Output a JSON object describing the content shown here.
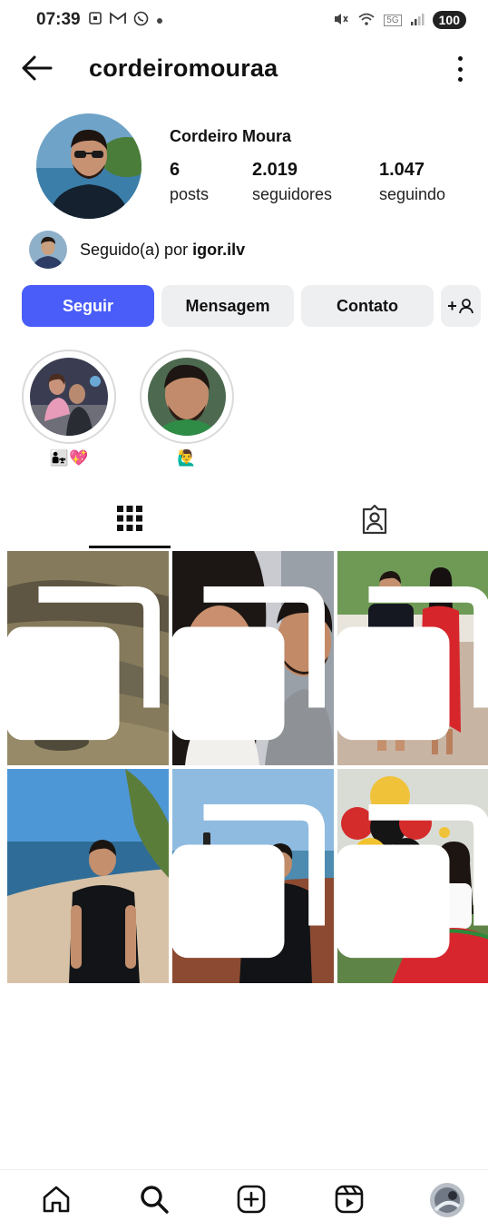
{
  "status_bar": {
    "time": "07:39",
    "left_icons": [
      "screenshot-icon",
      "gmail-icon",
      "whatsapp-icon",
      "dot-icon"
    ],
    "right_icons": [
      "mute-icon",
      "wifi-icon",
      "5g-icon",
      "signal-icon"
    ],
    "network": "5G",
    "battery": "100"
  },
  "header": {
    "username": "cordeiromouraa",
    "back_icon": "arrow-left-icon",
    "menu_icon": "kebab-menu-icon"
  },
  "profile": {
    "full_name": "Cordeiro Moura",
    "stats": [
      {
        "value": "6",
        "label": "posts"
      },
      {
        "value": "2.019",
        "label": "seguidores"
      },
      {
        "value": "1.047",
        "label": "seguindo"
      }
    ],
    "followed_by_prefix": "Seguido(a) por ",
    "followed_by_user": "igor.ilv"
  },
  "actions": {
    "follow": "Seguir",
    "message": "Mensagem",
    "contact": "Contato",
    "add_user_icon": "add-person-icon",
    "add_user_label": "+"
  },
  "highlights": [
    {
      "caption": "👨‍👧💖"
    },
    {
      "caption": "🙋‍♂️"
    }
  ],
  "tabs": {
    "active": "grid",
    "items": [
      "grid-icon",
      "tagged-icon"
    ]
  },
  "posts": [
    {
      "alt": "couple-on-rocks",
      "multi": true
    },
    {
      "alt": "selfie-couple",
      "multi": true
    },
    {
      "alt": "couple-deck",
      "multi": true
    },
    {
      "alt": "man-beach",
      "multi": false
    },
    {
      "alt": "man-selfie-beach",
      "multi": true
    },
    {
      "alt": "girl-balloons",
      "multi": true
    }
  ],
  "bottom_nav": [
    "home-icon",
    "search-icon",
    "create-icon",
    "reels-icon",
    "profile-avatar"
  ],
  "colors": {
    "primary_button": "#4a5df9",
    "secondary_button": "#eeeff1"
  }
}
